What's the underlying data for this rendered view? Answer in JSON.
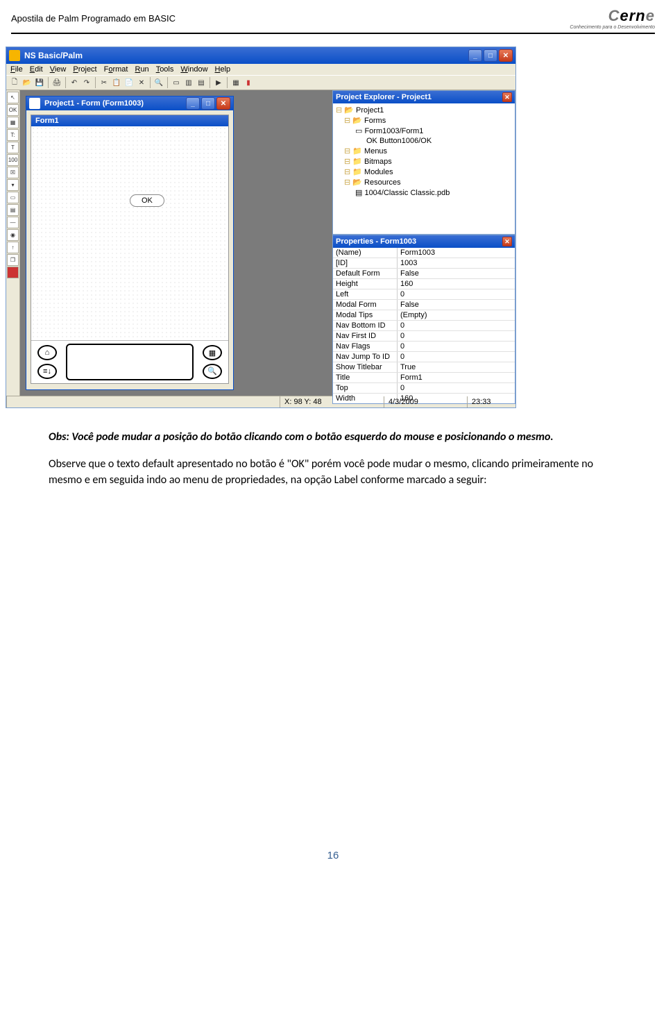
{
  "header": {
    "title": "Apostila de Palm Programado em BASIC",
    "logo_main": "Cerne",
    "logo_sub": "Conhecimento para o Desenvolvimento"
  },
  "app": {
    "window_title": "NS Basic/Palm",
    "menu": [
      "File",
      "Edit",
      "View",
      "Project",
      "Format",
      "Run",
      "Tools",
      "Window",
      "Help"
    ],
    "child_window_title": "Project1 - Form (Form1003)",
    "form_header": "Form1",
    "ok_button": "OK",
    "explorer": {
      "title": "Project Explorer - Project1",
      "nodes": [
        {
          "lvl": 0,
          "icon": "📂",
          "label": "Project1"
        },
        {
          "lvl": 1,
          "icon": "📂",
          "label": "Forms"
        },
        {
          "lvl": 2,
          "icon": "▭",
          "label": "Form1003/Form1"
        },
        {
          "lvl": 3,
          "icon": "OK",
          "label": "Button1006/OK"
        },
        {
          "lvl": 1,
          "icon": "📁",
          "label": "Menus"
        },
        {
          "lvl": 1,
          "icon": "📁",
          "label": "Bitmaps"
        },
        {
          "lvl": 1,
          "icon": "📁",
          "label": "Modules"
        },
        {
          "lvl": 1,
          "icon": "📂",
          "label": "Resources"
        },
        {
          "lvl": 2,
          "icon": "▤",
          "label": "1004/Classic Classic.pdb"
        }
      ]
    },
    "properties": {
      "title": "Properties - Form1003",
      "rows": [
        {
          "k": "(Name)",
          "v": "Form1003"
        },
        {
          "k": "[ID]",
          "v": "1003"
        },
        {
          "k": "Default Form",
          "v": "False"
        },
        {
          "k": "Height",
          "v": "160"
        },
        {
          "k": "Left",
          "v": "0"
        },
        {
          "k": "Modal Form",
          "v": "False"
        },
        {
          "k": "Modal Tips",
          "v": "(Empty)"
        },
        {
          "k": "Nav Bottom ID",
          "v": "0"
        },
        {
          "k": "Nav First ID",
          "v": "0"
        },
        {
          "k": "Nav Flags",
          "v": "0"
        },
        {
          "k": "Nav Jump To ID",
          "v": "0"
        },
        {
          "k": "Show Titlebar",
          "v": "True"
        },
        {
          "k": "Title",
          "v": "Form1"
        },
        {
          "k": "Top",
          "v": "0"
        },
        {
          "k": "Width",
          "v": "160"
        }
      ]
    },
    "status": {
      "xy": "X: 98   Y: 48",
      "date": "4/3/2009",
      "time": "23:33"
    }
  },
  "body": {
    "p1": "Obs: Você pode mudar a posição do botão clicando com o botão esquerdo do mouse e posicionando o mesmo.",
    "p2": "Observe que o texto default apresentado no botão é \"OK\" porém você pode mudar o mesmo, clicando primeiramente no mesmo e em seguida indo ao menu de propriedades, na opção Label conforme marcado a seguir:"
  },
  "page_number": "16"
}
